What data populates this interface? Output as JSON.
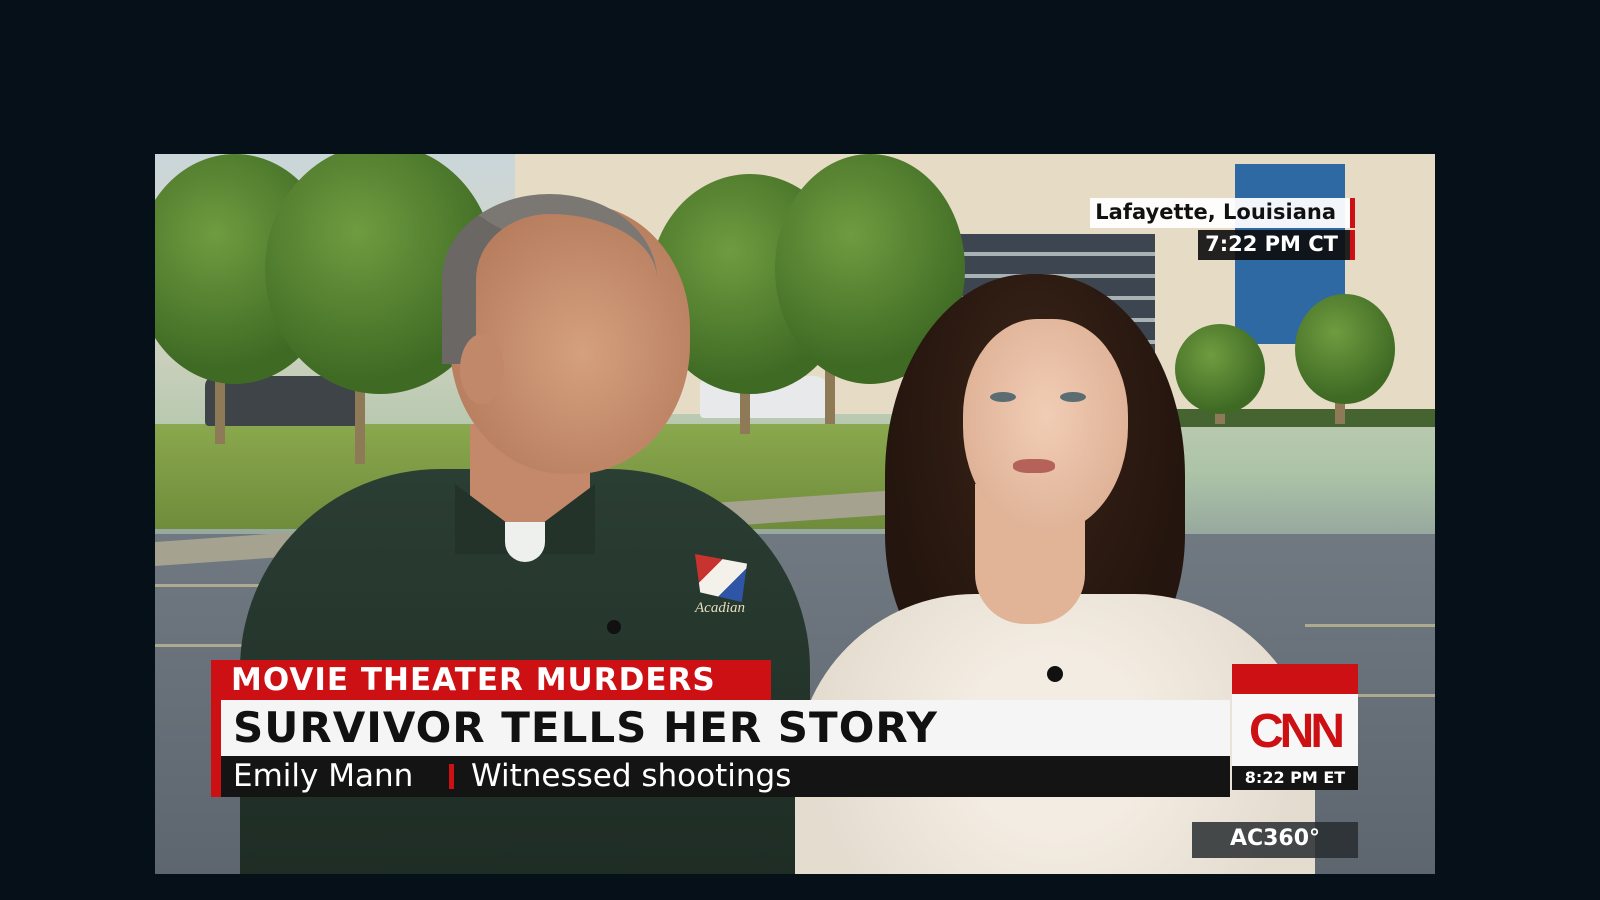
{
  "location": {
    "place": "Lafayette, Louisiana",
    "local_time": "7:22 PM CT"
  },
  "chyron": {
    "kicker": "MOVIE THEATER MURDERS",
    "headline": "SURVIVOR TELLS HER STORY",
    "name": "Emily Mann",
    "description": "Witnessed shootings"
  },
  "network": {
    "logo": "CNN",
    "time_et": "8:22 PM ET",
    "show": "AC360°"
  },
  "shirt_logo_text": "Acadian",
  "colors": {
    "brand_red": "#cc1014",
    "background": "#061018"
  }
}
